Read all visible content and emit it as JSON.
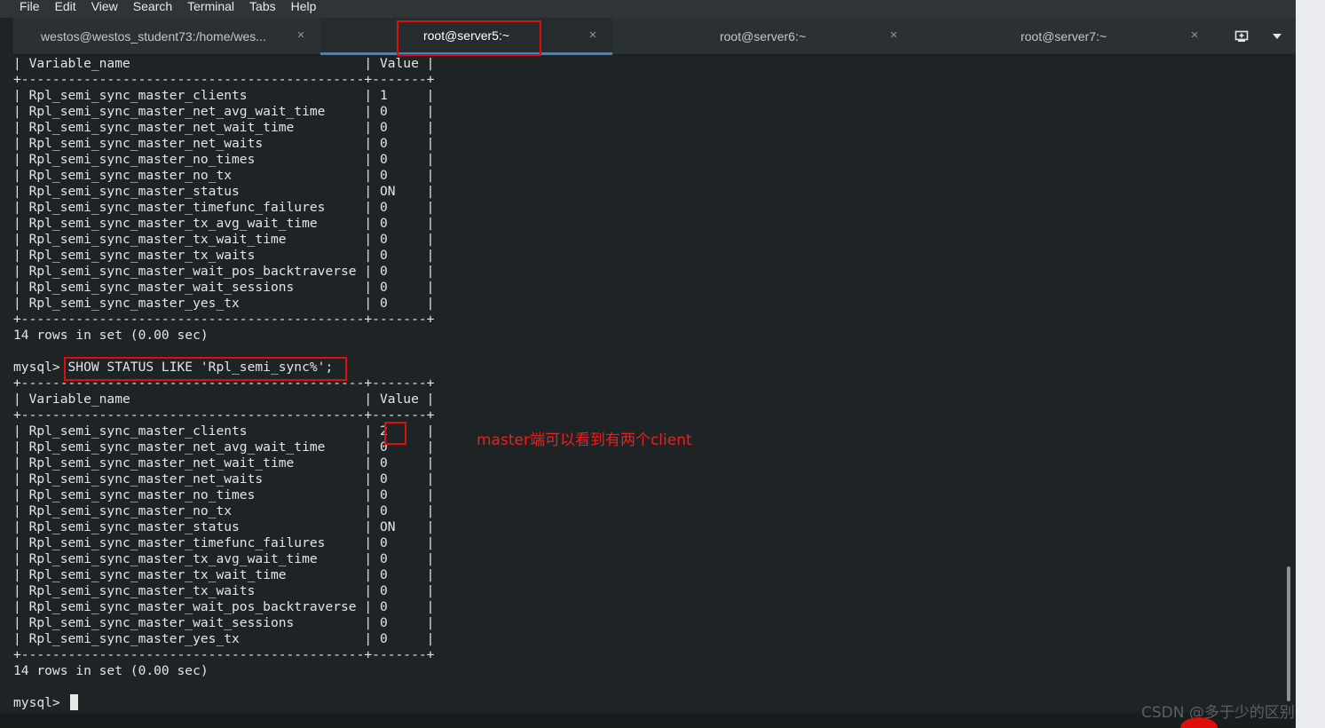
{
  "menu": {
    "items": [
      "File",
      "Edit",
      "View",
      "Search",
      "Terminal",
      "Tabs",
      "Help"
    ]
  },
  "tabs": [
    {
      "label": "westos@westos_student73:/home/wes...",
      "active": false
    },
    {
      "label": "root@server5:~",
      "active": true
    },
    {
      "label": "root@server6:~",
      "active": false
    },
    {
      "label": "root@server7:~",
      "active": false
    }
  ],
  "tab_close_glyph": "×",
  "terminal": {
    "lines": [
      "| Variable_name                              | Value |",
      "+--------------------------------------------+-------+",
      "| Rpl_semi_sync_master_clients               | 1     |",
      "| Rpl_semi_sync_master_net_avg_wait_time     | 0     |",
      "| Rpl_semi_sync_master_net_wait_time         | 0     |",
      "| Rpl_semi_sync_master_net_waits             | 0     |",
      "| Rpl_semi_sync_master_no_times              | 0     |",
      "| Rpl_semi_sync_master_no_tx                 | 0     |",
      "| Rpl_semi_sync_master_status                | ON    |",
      "| Rpl_semi_sync_master_timefunc_failures     | 0     |",
      "| Rpl_semi_sync_master_tx_avg_wait_time      | 0     |",
      "| Rpl_semi_sync_master_tx_wait_time          | 0     |",
      "| Rpl_semi_sync_master_tx_waits              | 0     |",
      "| Rpl_semi_sync_master_wait_pos_backtraverse | 0     |",
      "| Rpl_semi_sync_master_wait_sessions         | 0     |",
      "| Rpl_semi_sync_master_yes_tx                | 0     |",
      "+--------------------------------------------+-------+",
      "14 rows in set (0.00 sec)",
      "",
      "mysql> SHOW STATUS LIKE 'Rpl_semi_sync%';",
      "+--------------------------------------------+-------+",
      "| Variable_name                              | Value |",
      "+--------------------------------------------+-------+",
      "| Rpl_semi_sync_master_clients               | 2     |",
      "| Rpl_semi_sync_master_net_avg_wait_time     | 0     |",
      "| Rpl_semi_sync_master_net_wait_time         | 0     |",
      "| Rpl_semi_sync_master_net_waits             | 0     |",
      "| Rpl_semi_sync_master_no_times              | 0     |",
      "| Rpl_semi_sync_master_no_tx                 | 0     |",
      "| Rpl_semi_sync_master_status                | ON    |",
      "| Rpl_semi_sync_master_timefunc_failures     | 0     |",
      "| Rpl_semi_sync_master_tx_avg_wait_time      | 0     |",
      "| Rpl_semi_sync_master_tx_wait_time          | 0     |",
      "| Rpl_semi_sync_master_tx_waits              | 0     |",
      "| Rpl_semi_sync_master_wait_pos_backtraverse | 0     |",
      "| Rpl_semi_sync_master_wait_sessions         | 0     |",
      "| Rpl_semi_sync_master_yes_tx                | 0     |",
      "+--------------------------------------------+-------+",
      "14 rows in set (0.00 sec)",
      "",
      "mysql> "
    ]
  },
  "annotation": "master端可以看到有两个client",
  "watermark": "CSDN @多于少的区别",
  "colors": {
    "annotation": "#e82020",
    "active_tab_underline": "#3e86c9",
    "terminal_bg": "#1e2426"
  },
  "icons": {
    "new_tab": "new-tab-icon",
    "menu": "chevron-down-icon"
  }
}
